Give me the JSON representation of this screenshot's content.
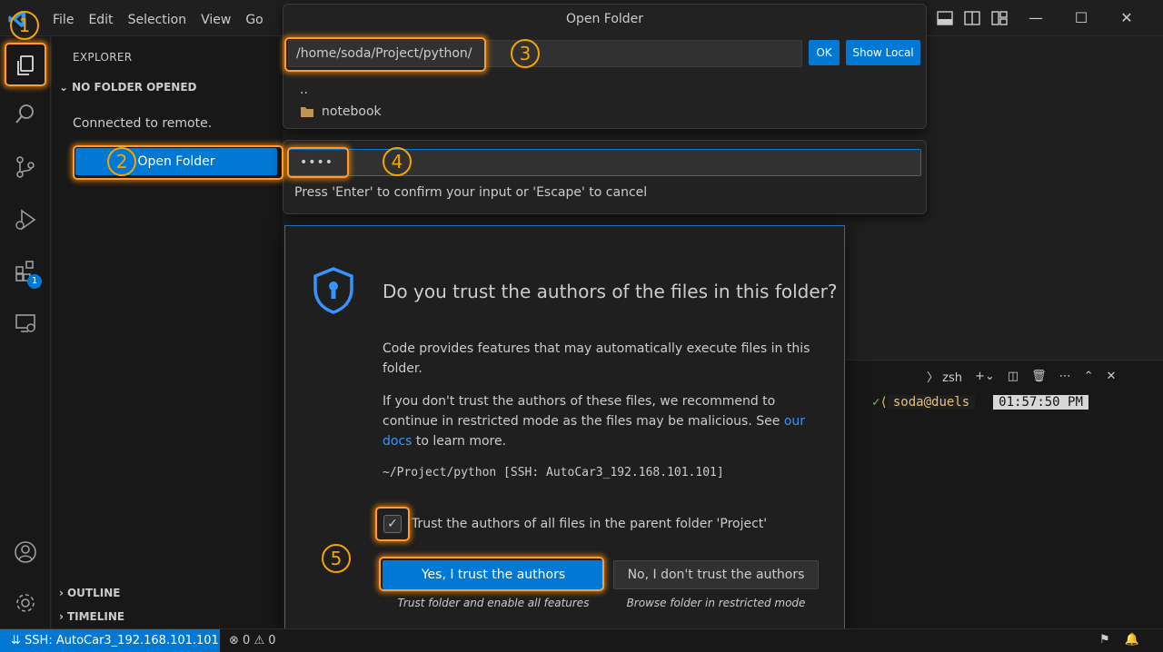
{
  "menu": {
    "items": [
      "File",
      "Edit",
      "Selection",
      "View",
      "Go"
    ]
  },
  "activity_bar": {
    "extensions_badge": "1"
  },
  "sidebar": {
    "title": "EXPLORER",
    "section": "NO FOLDER OPENED",
    "connected": "Connected to remote.",
    "open_folder_label": "Open Folder",
    "outline": "OUTLINE",
    "timeline": "TIMELINE"
  },
  "open_folder_picker": {
    "title": "Open Folder",
    "path_value": "/home/soda/Project/python/",
    "ok_label": "OK",
    "show_local_label": "Show Local",
    "items": [
      "..",
      "notebook"
    ]
  },
  "password_prompt": {
    "value": "••••",
    "hint": "Press 'Enter' to confirm your input or 'Escape' to cancel"
  },
  "trust_dialog": {
    "title": "Do you trust the authors of the files in this folder?",
    "p1": "Code provides features that may automatically execute files in this folder.",
    "p2_before": "If you don't trust the authors of these files, we recommend to continue in restricted mode as the files may be malicious. See ",
    "p2_link": "our docs",
    "p2_after": " to learn more.",
    "path": "~/Project/python [SSH: AutoCar3_192.168.101.101]",
    "checkbox_label": "Trust the authors of all files in the parent folder 'Project'",
    "yes_label": "Yes, I trust the authors",
    "yes_caption": "Trust folder and enable all features",
    "no_label": "No, I don't trust the authors",
    "no_caption": "Browse folder in restricted mode"
  },
  "terminal": {
    "shell": "zsh",
    "prompt_user": "soda@duels",
    "prompt_time": "01:57:50 PM"
  },
  "statusbar": {
    "remote": "SSH: AutoCar3_192.168.101.101",
    "errors": "0",
    "warnings": "0"
  },
  "annotations": [
    "1",
    "2",
    "3",
    "4",
    "5"
  ],
  "colors": {
    "accent": "#0078d4",
    "highlight": "#ff9b2f",
    "annotation": "#f5a400",
    "link": "#3794ff"
  }
}
